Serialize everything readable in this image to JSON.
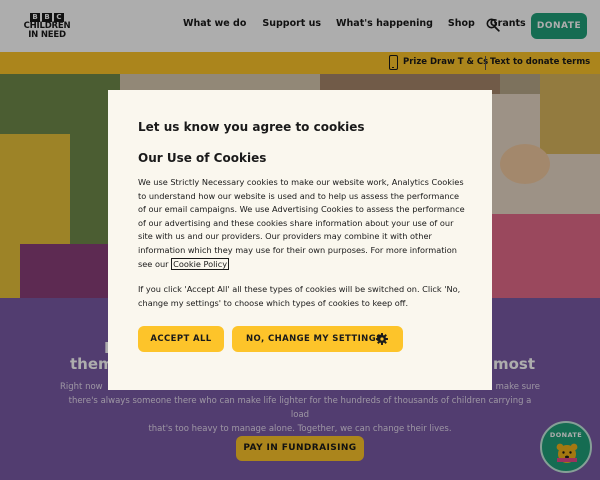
{
  "header": {
    "logo": {
      "line1": "BBC",
      "line2": "CHILDREN",
      "line3": "IN NEED"
    },
    "nav": [
      "What we do",
      "Support us",
      "What's happening",
      "Shop",
      "Grants"
    ],
    "search_icon": "search-icon",
    "donate_label": "DONATE"
  },
  "info_bar": {
    "phone_icon": "phone-icon",
    "links": [
      "Prize Draw T & Cs",
      "Text to donate terms"
    ]
  },
  "section": {
    "heading_line1_left": "I",
    "heading_line2_left": "them",
    "heading_line1_right": "e",
    "heading_line2_right": "most",
    "body_line1": "Right now",
    "body_line1_right": "make sure",
    "body_line2": "there's always someone there who can make life lighter for the hundreds of thousands of children carrying a load",
    "body_line3": "that's too heavy to manage alone. Together, we can change their lives.",
    "cta_label": "PAY IN FUNDRAISING"
  },
  "donate_badge": {
    "label": "DONATE",
    "icon": "bear-icon"
  },
  "cookie_modal": {
    "title": "Let us know you agree to cookies",
    "subtitle": "Our Use of Cookies",
    "body": "We use Strictly Necessary cookies to make our website work, Analytics Cookies to understand how our website is used and to help us assess the performance of our email campaigns. We use Advertising Cookies to assess the performance of our advertising and these cookies share information about your use of our site with us and our providers. Our providers may combine it with other information which they may use for their own purposes. For more information see our",
    "policy_link": "Cookie Policy",
    "body2": "If you click 'Accept All' all these types of cookies will be switched on. Click 'No, change my settings' to choose which types of cookies to keep off.",
    "accept_label": "ACCEPT ALL",
    "change_label": "NO, CHANGE MY SETTINGS",
    "change_icon": "gear-icon"
  },
  "colors": {
    "accent_green": "#1fa07a",
    "accent_yellow": "#fdc42a",
    "purple": "#7a5aa5"
  }
}
